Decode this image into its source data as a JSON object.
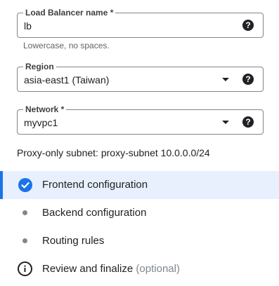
{
  "form": {
    "lb_name": {
      "label": "Load Balancer name *",
      "value": "lb",
      "hint": "Lowercase, no spaces.",
      "help_icon": "help-circle-icon"
    },
    "region": {
      "label": "Region",
      "value": "asia-east1 (Taiwan)",
      "dropdown_icon": "caret-down-icon",
      "help_icon": "help-circle-icon"
    },
    "network": {
      "label": "Network *",
      "value": "myvpc1",
      "dropdown_icon": "caret-down-icon",
      "help_icon": "help-circle-icon"
    },
    "subnet_text": "Proxy-only subnet: proxy-subnet 10.0.0.0/24",
    "help_glyph": "?"
  },
  "steps": [
    {
      "label": "Frontend configuration",
      "state": "completed",
      "icon": "check-circle-icon"
    },
    {
      "label": "Backend configuration",
      "state": "pending",
      "icon": "dot-icon"
    },
    {
      "label": "Routing rules",
      "state": "pending",
      "icon": "dot-icon"
    },
    {
      "label": "Review and finalize",
      "suffix": "(optional)",
      "state": "info",
      "icon": "info-icon"
    }
  ],
  "colors": {
    "accent": "#1a73e8",
    "active_bg": "#e8f0fe",
    "border": "#80868b"
  }
}
